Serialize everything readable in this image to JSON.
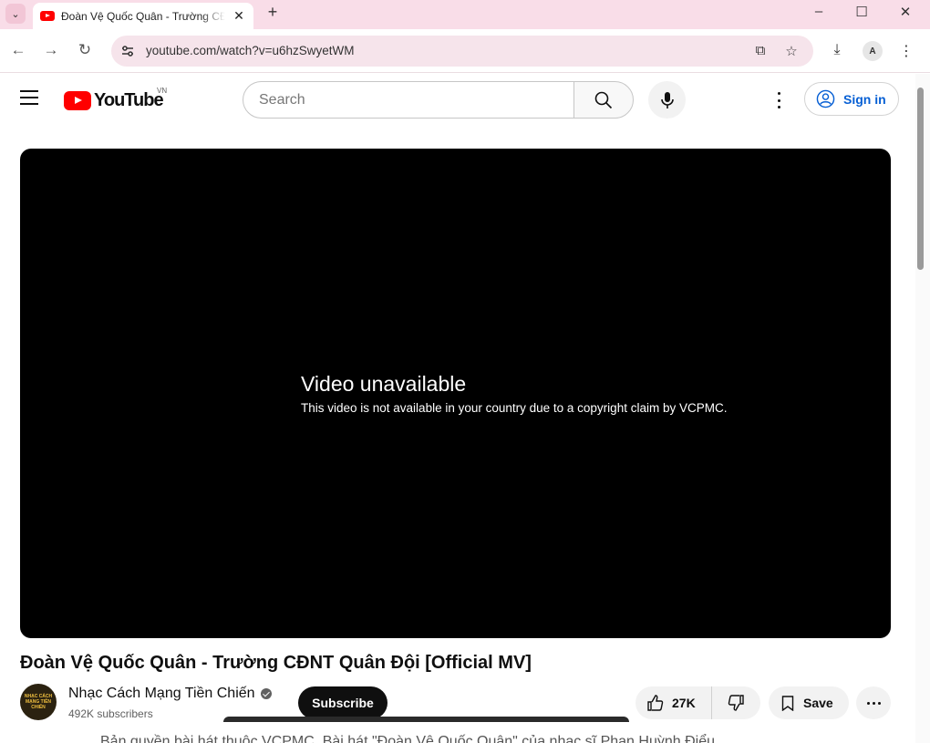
{
  "browser": {
    "tab_title": "Đoàn Vệ Quốc Quân - Trường CĐNT Quân Đội [Official MV]",
    "tab_close": "✕",
    "new_tab": "+",
    "url": "youtube.com/watch?v=u6hzSwyetWM"
  },
  "youtube": {
    "logo_text": "YouTube",
    "country_code": "VN",
    "search_placeholder": "Search",
    "sign_in_label": "Sign in"
  },
  "player": {
    "error_title": "Video unavailable",
    "error_message": "This video is not available in your country due to a copyright claim by VCPMC."
  },
  "video": {
    "title": "Đoàn Vệ Quốc Quân - Trường CĐNT Quân Đội [Official MV]",
    "channel_name": "Nhạc Cách Mạng Tiền Chiến",
    "subscribers": "492K subscribers",
    "subscribe_label": "Subscribe",
    "like_count": "27K",
    "save_label": "Save",
    "avatar_text": "NHẠC CÁCH MẠNG TIỀN CHIẾN",
    "description_peek": "Bản quyền bài hát thuộc VCPMC. Bài hát \"Đoàn Vệ Quốc Quân\" của nhạc sĩ Phan Huỳnh Điểu"
  },
  "icons": {
    "tab_list": "chevron-down-icon",
    "favicon": "youtube-favicon-icon",
    "back": "arrow-left-icon",
    "forward": "arrow-right-icon",
    "reload": "reload-icon",
    "site_info": "tune-icon",
    "install": "install-app-icon",
    "bookmark": "star-icon",
    "download": "download-icon",
    "profile": "profile-icon",
    "menu": "kebab-icon",
    "search": "search-icon",
    "mic": "mic-icon",
    "like": "thumbs-up-icon",
    "dislike": "thumbs-down-icon",
    "save": "bookmark-icon",
    "more": "more-horizontal-icon"
  },
  "colors": {
    "tab_strip": "#f9dde8",
    "youtube_red": "#ff0000",
    "sign_in_blue": "#065fd4",
    "player_bg": "#000000"
  }
}
